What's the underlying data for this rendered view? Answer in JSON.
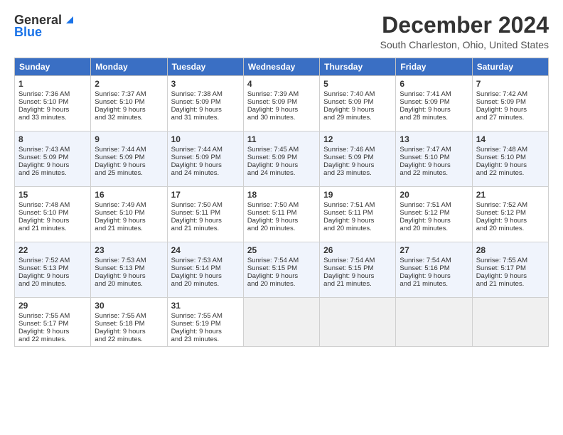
{
  "logo": {
    "line1": "General",
    "line2": "Blue"
  },
  "title": "December 2024",
  "subtitle": "South Charleston, Ohio, United States",
  "days_of_week": [
    "Sunday",
    "Monday",
    "Tuesday",
    "Wednesday",
    "Thursday",
    "Friday",
    "Saturday"
  ],
  "weeks": [
    [
      {
        "num": "1",
        "lines": [
          "Sunrise: 7:36 AM",
          "Sunset: 5:10 PM",
          "Daylight: 9 hours",
          "and 33 minutes."
        ]
      },
      {
        "num": "2",
        "lines": [
          "Sunrise: 7:37 AM",
          "Sunset: 5:10 PM",
          "Daylight: 9 hours",
          "and 32 minutes."
        ]
      },
      {
        "num": "3",
        "lines": [
          "Sunrise: 7:38 AM",
          "Sunset: 5:09 PM",
          "Daylight: 9 hours",
          "and 31 minutes."
        ]
      },
      {
        "num": "4",
        "lines": [
          "Sunrise: 7:39 AM",
          "Sunset: 5:09 PM",
          "Daylight: 9 hours",
          "and 30 minutes."
        ]
      },
      {
        "num": "5",
        "lines": [
          "Sunrise: 7:40 AM",
          "Sunset: 5:09 PM",
          "Daylight: 9 hours",
          "and 29 minutes."
        ]
      },
      {
        "num": "6",
        "lines": [
          "Sunrise: 7:41 AM",
          "Sunset: 5:09 PM",
          "Daylight: 9 hours",
          "and 28 minutes."
        ]
      },
      {
        "num": "7",
        "lines": [
          "Sunrise: 7:42 AM",
          "Sunset: 5:09 PM",
          "Daylight: 9 hours",
          "and 27 minutes."
        ]
      }
    ],
    [
      {
        "num": "8",
        "lines": [
          "Sunrise: 7:43 AM",
          "Sunset: 5:09 PM",
          "Daylight: 9 hours",
          "and 26 minutes."
        ]
      },
      {
        "num": "9",
        "lines": [
          "Sunrise: 7:44 AM",
          "Sunset: 5:09 PM",
          "Daylight: 9 hours",
          "and 25 minutes."
        ]
      },
      {
        "num": "10",
        "lines": [
          "Sunrise: 7:44 AM",
          "Sunset: 5:09 PM",
          "Daylight: 9 hours",
          "and 24 minutes."
        ]
      },
      {
        "num": "11",
        "lines": [
          "Sunrise: 7:45 AM",
          "Sunset: 5:09 PM",
          "Daylight: 9 hours",
          "and 24 minutes."
        ]
      },
      {
        "num": "12",
        "lines": [
          "Sunrise: 7:46 AM",
          "Sunset: 5:09 PM",
          "Daylight: 9 hours",
          "and 23 minutes."
        ]
      },
      {
        "num": "13",
        "lines": [
          "Sunrise: 7:47 AM",
          "Sunset: 5:10 PM",
          "Daylight: 9 hours",
          "and 22 minutes."
        ]
      },
      {
        "num": "14",
        "lines": [
          "Sunrise: 7:48 AM",
          "Sunset: 5:10 PM",
          "Daylight: 9 hours",
          "and 22 minutes."
        ]
      }
    ],
    [
      {
        "num": "15",
        "lines": [
          "Sunrise: 7:48 AM",
          "Sunset: 5:10 PM",
          "Daylight: 9 hours",
          "and 21 minutes."
        ]
      },
      {
        "num": "16",
        "lines": [
          "Sunrise: 7:49 AM",
          "Sunset: 5:10 PM",
          "Daylight: 9 hours",
          "and 21 minutes."
        ]
      },
      {
        "num": "17",
        "lines": [
          "Sunrise: 7:50 AM",
          "Sunset: 5:11 PM",
          "Daylight: 9 hours",
          "and 21 minutes."
        ]
      },
      {
        "num": "18",
        "lines": [
          "Sunrise: 7:50 AM",
          "Sunset: 5:11 PM",
          "Daylight: 9 hours",
          "and 20 minutes."
        ]
      },
      {
        "num": "19",
        "lines": [
          "Sunrise: 7:51 AM",
          "Sunset: 5:11 PM",
          "Daylight: 9 hours",
          "and 20 minutes."
        ]
      },
      {
        "num": "20",
        "lines": [
          "Sunrise: 7:51 AM",
          "Sunset: 5:12 PM",
          "Daylight: 9 hours",
          "and 20 minutes."
        ]
      },
      {
        "num": "21",
        "lines": [
          "Sunrise: 7:52 AM",
          "Sunset: 5:12 PM",
          "Daylight: 9 hours",
          "and 20 minutes."
        ]
      }
    ],
    [
      {
        "num": "22",
        "lines": [
          "Sunrise: 7:52 AM",
          "Sunset: 5:13 PM",
          "Daylight: 9 hours",
          "and 20 minutes."
        ]
      },
      {
        "num": "23",
        "lines": [
          "Sunrise: 7:53 AM",
          "Sunset: 5:13 PM",
          "Daylight: 9 hours",
          "and 20 minutes."
        ]
      },
      {
        "num": "24",
        "lines": [
          "Sunrise: 7:53 AM",
          "Sunset: 5:14 PM",
          "Daylight: 9 hours",
          "and 20 minutes."
        ]
      },
      {
        "num": "25",
        "lines": [
          "Sunrise: 7:54 AM",
          "Sunset: 5:15 PM",
          "Daylight: 9 hours",
          "and 20 minutes."
        ]
      },
      {
        "num": "26",
        "lines": [
          "Sunrise: 7:54 AM",
          "Sunset: 5:15 PM",
          "Daylight: 9 hours",
          "and 21 minutes."
        ]
      },
      {
        "num": "27",
        "lines": [
          "Sunrise: 7:54 AM",
          "Sunset: 5:16 PM",
          "Daylight: 9 hours",
          "and 21 minutes."
        ]
      },
      {
        "num": "28",
        "lines": [
          "Sunrise: 7:55 AM",
          "Sunset: 5:17 PM",
          "Daylight: 9 hours",
          "and 21 minutes."
        ]
      }
    ],
    [
      {
        "num": "29",
        "lines": [
          "Sunrise: 7:55 AM",
          "Sunset: 5:17 PM",
          "Daylight: 9 hours",
          "and 22 minutes."
        ]
      },
      {
        "num": "30",
        "lines": [
          "Sunrise: 7:55 AM",
          "Sunset: 5:18 PM",
          "Daylight: 9 hours",
          "and 22 minutes."
        ]
      },
      {
        "num": "31",
        "lines": [
          "Sunrise: 7:55 AM",
          "Sunset: 5:19 PM",
          "Daylight: 9 hours",
          "and 23 minutes."
        ]
      },
      null,
      null,
      null,
      null
    ]
  ]
}
